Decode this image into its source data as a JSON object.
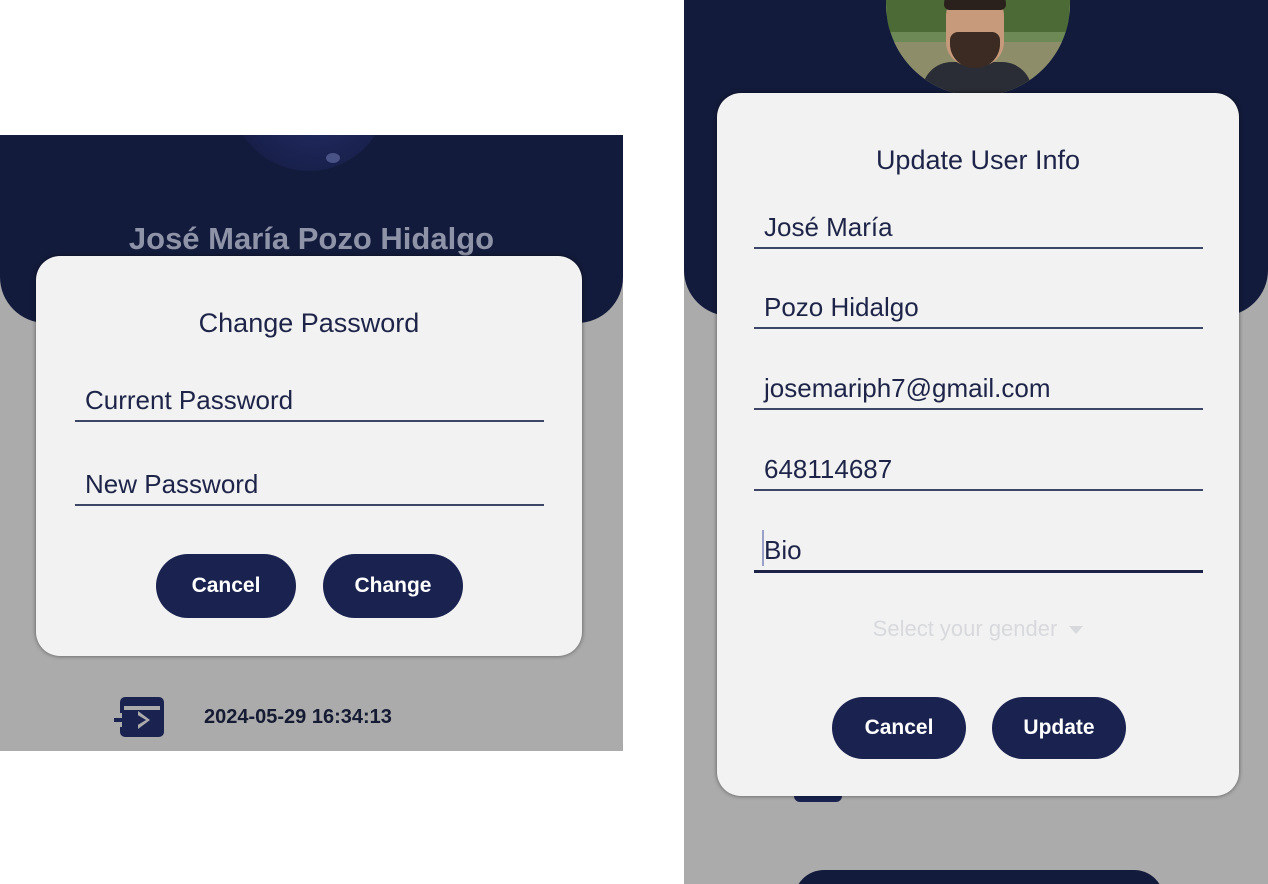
{
  "left_screen": {
    "profile_name": "José María Pozo Hidalgo",
    "dialog": {
      "title": "Change Password",
      "fields": {
        "current_password": "Current Password",
        "new_password": "New Password"
      },
      "buttons": {
        "cancel": "Cancel",
        "change": "Change"
      }
    },
    "footer": {
      "icon": "logout-icon",
      "timestamp": "2024-05-29 16:34:13"
    }
  },
  "right_screen": {
    "dialog": {
      "title": "Update User Info",
      "fields": {
        "first_name": "José María",
        "last_name": "Pozo Hidalgo",
        "email": "josemariph7@gmail.com",
        "phone": "648114687",
        "bio": "Bio"
      },
      "gender_select": {
        "placeholder": "Select your gender",
        "icon": "chevron-down-icon"
      },
      "buttons": {
        "cancel": "Cancel",
        "update": "Update"
      }
    }
  },
  "colors": {
    "primary": "#1a2350",
    "header": "#131b3c",
    "dialog_bg": "#f2f2f3",
    "overlay": "#ababab",
    "text": "#1d2448"
  }
}
